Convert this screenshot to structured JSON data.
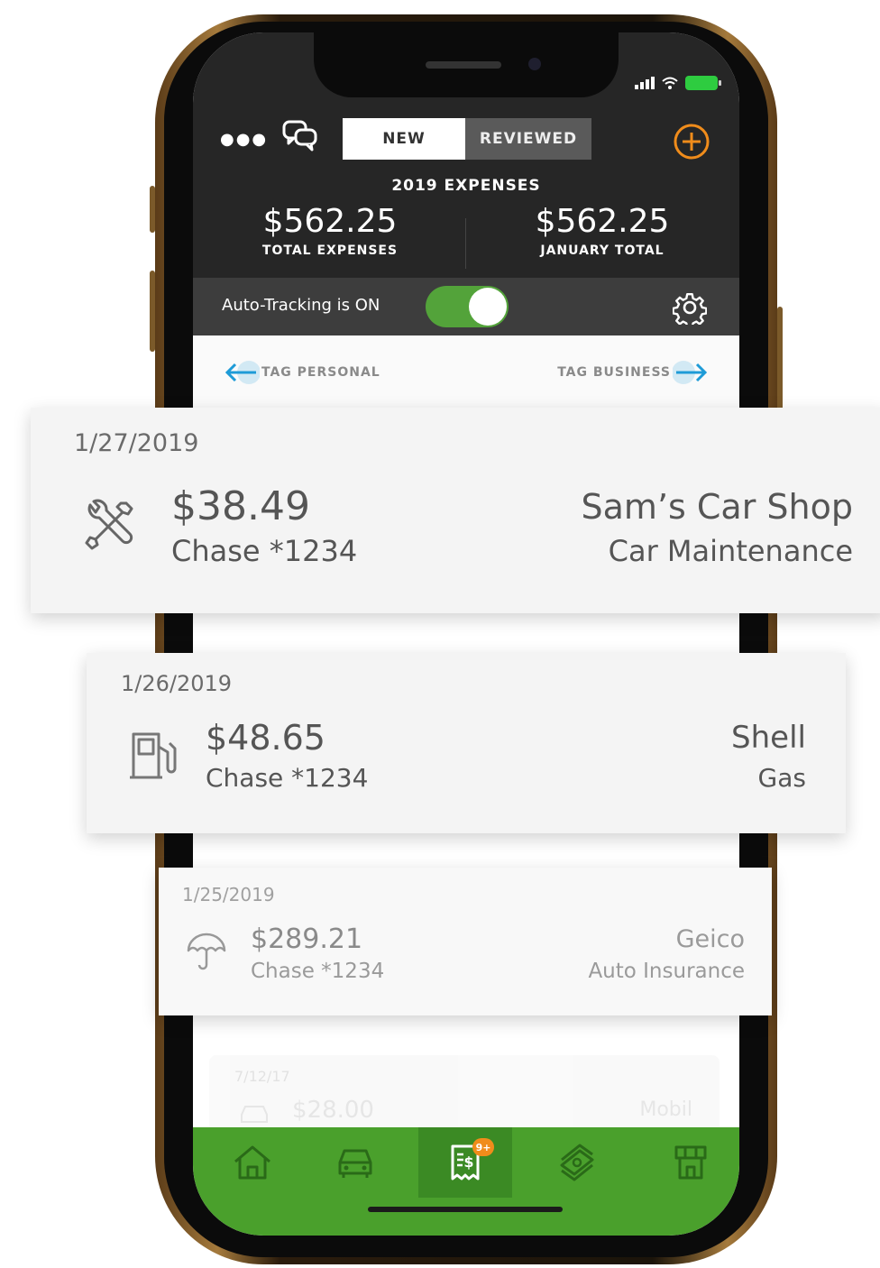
{
  "header": {
    "more_icon": "more-dots-icon",
    "chat_icon": "chat-bubbles-icon",
    "add_icon": "plus-circle-icon",
    "tabs": [
      {
        "label": "NEW",
        "active": true
      },
      {
        "label": "REVIEWED",
        "active": false
      }
    ],
    "year_label": "2019 EXPENSES",
    "total_expenses": {
      "amount": "$562.25",
      "label": "TOTAL EXPENSES"
    },
    "month_total": {
      "amount": "$562.25",
      "label": "JANUARY TOTAL"
    }
  },
  "tracking": {
    "label": "Auto-Tracking is ON",
    "enabled": true,
    "settings_icon": "gear-icon"
  },
  "swipe_hints": {
    "left": "TAG PERSONAL",
    "right": "TAG BUSINESS"
  },
  "expenses": [
    {
      "date": "1/27/2019",
      "amount": "$38.49",
      "account": "Chase *1234",
      "merchant": "Sam’s Car Shop",
      "category": "Car Maintenance",
      "icon": "wrench-screwdriver-icon"
    },
    {
      "date": "1/26/2019",
      "amount": "$48.65",
      "account": "Chase *1234",
      "merchant": "Shell",
      "category": "Gas",
      "icon": "gas-pump-icon"
    },
    {
      "date": "1/25/2019",
      "amount": "$289.21",
      "account": "Chase *1234",
      "merchant": "Geico",
      "category": "Auto Insurance",
      "icon": "umbrella-icon"
    },
    {
      "date": "7/12/17",
      "amount": "$28.00",
      "merchant": "Mobil",
      "icon": "car-icon"
    }
  ],
  "tabbar": {
    "items": [
      {
        "icon": "home-icon"
      },
      {
        "icon": "car-icon"
      },
      {
        "icon": "receipt-icon",
        "badge": "9+",
        "active": true
      },
      {
        "icon": "money-stack-icon"
      },
      {
        "icon": "store-icon"
      }
    ]
  },
  "colors": {
    "accent_green": "#4aa02c",
    "accent_orange": "#f08c1b",
    "swipe_blue": "#1e9bd7",
    "header_dark": "#262626"
  }
}
